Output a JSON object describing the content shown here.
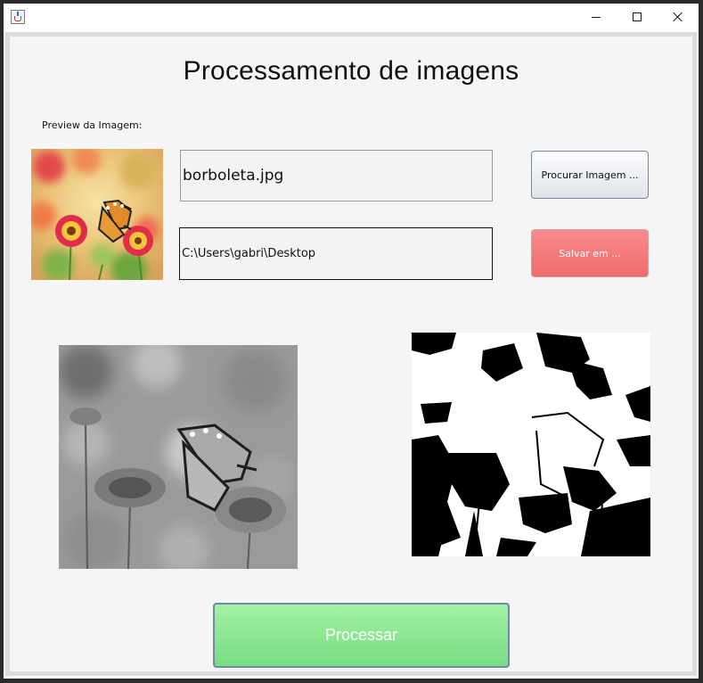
{
  "window": {
    "controls": {
      "minimize_icon": "minimize-icon",
      "maximize_icon": "maximize-icon",
      "close_icon": "close-icon"
    }
  },
  "main": {
    "title": "Processamento de imagens",
    "preview_label": "Preview da Imagem:",
    "file_name_value": "borboleta.jpg",
    "save_path_value": "C:\\Users\\gabri\\Desktop",
    "browse_button": "Procurar Imagem ...",
    "save_button": "Salvar em ...",
    "process_button": "Processar"
  },
  "colors": {
    "save_button": "#ef6c6c",
    "process_button": "#78dd82",
    "background": "#f5f5f6"
  }
}
